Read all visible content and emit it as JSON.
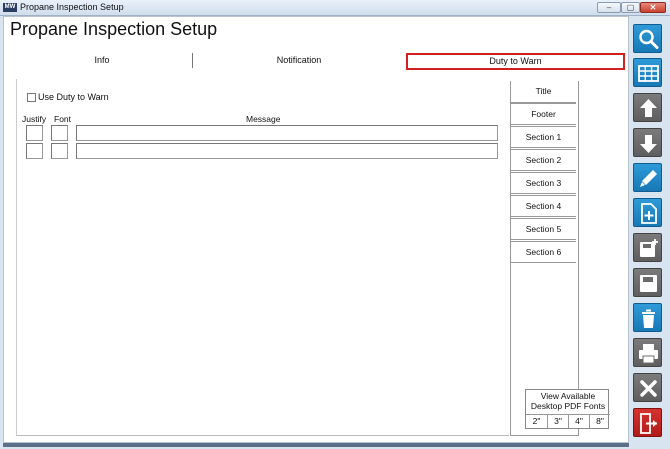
{
  "window": {
    "title": "Propane Inspection Setup",
    "app_icon_text": "MW",
    "min_symbol": "–",
    "max_symbol": "▢",
    "close_symbol": "✕"
  },
  "page": {
    "title": "Propane Inspection Setup"
  },
  "tabs": [
    {
      "label": "Info"
    },
    {
      "label": "Notification"
    },
    {
      "label": "Duty to Warn",
      "active": true
    }
  ],
  "form": {
    "use_duty_to_warn_label": "Use Duty to Warn",
    "use_duty_to_warn_checked": false,
    "columns": {
      "justify": "Justify",
      "font": "Font",
      "message": "Message"
    },
    "rows": [
      {
        "justify": "",
        "font": "",
        "message": ""
      },
      {
        "justify": "",
        "font": "",
        "message": ""
      }
    ]
  },
  "sections": [
    {
      "label": "Title",
      "selected": true
    },
    {
      "label": "Footer"
    },
    {
      "label": "Section 1"
    },
    {
      "label": "Section 2"
    },
    {
      "label": "Section 3"
    },
    {
      "label": "Section 4"
    },
    {
      "label": "Section 5"
    },
    {
      "label": "Section 6"
    }
  ],
  "pdf_fonts": {
    "label_line1": "View Available",
    "label_line2": "Desktop PDF Fonts",
    "sizes": [
      "2\"",
      "3\"",
      "4\"",
      "8\""
    ]
  },
  "toolbar": [
    {
      "name": "search-icon",
      "color": "#1f86c7"
    },
    {
      "name": "grid-icon",
      "color": "#1f86c7"
    },
    {
      "name": "arrow-up-icon",
      "color": "#6b6b6b"
    },
    {
      "name": "arrow-down-icon",
      "color": "#6b6b6b"
    },
    {
      "name": "pencil-icon",
      "color": "#1f86c7"
    },
    {
      "name": "new-document-icon",
      "color": "#1f86c7"
    },
    {
      "name": "save-as-icon",
      "color": "#6b6b6b"
    },
    {
      "name": "save-icon",
      "color": "#6b6b6b"
    },
    {
      "name": "trash-icon",
      "color": "#1f86c7"
    },
    {
      "name": "print-icon",
      "color": "#6b6b6b"
    },
    {
      "name": "close-icon",
      "color": "#6b6b6b"
    },
    {
      "name": "exit-icon",
      "color": "#c4211e"
    }
  ],
  "colors": {
    "active_tab_border": "#d21f1f",
    "toolbar_blue": "#1f86c7",
    "toolbar_gray": "#6b6b6b",
    "exit_red": "#c4211e"
  }
}
